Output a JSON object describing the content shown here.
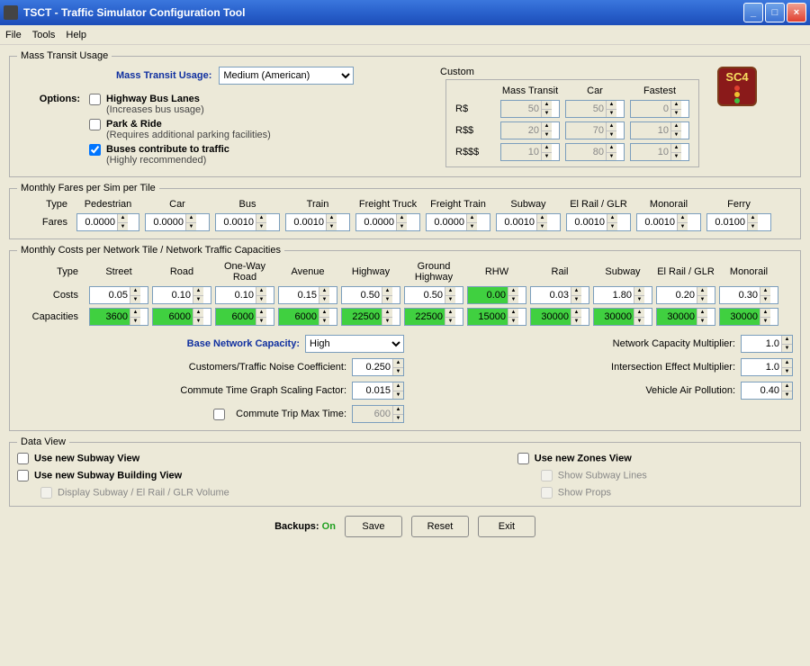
{
  "window": {
    "title": "TSCT - Traffic Simulator Configuration Tool"
  },
  "menu": {
    "file": "File",
    "tools": "Tools",
    "help": "Help"
  },
  "mtUsage": {
    "legend": "Mass Transit Usage",
    "label": "Mass Transit Usage:",
    "value": "Medium (American)",
    "optionsLabel": "Options:",
    "opt1": "Highway Bus Lanes",
    "opt1sub": "(Increases bus usage)",
    "opt2": "Park & Ride",
    "opt2sub": "(Requires additional parking facilities)",
    "opt3": "Buses contribute to traffic",
    "opt3sub": "(Highly recommended)",
    "customLabel": "Custom",
    "col1": "Mass Transit",
    "col2": "Car",
    "col3": "Fastest",
    "r1": "R$",
    "r2": "R$$",
    "r3": "R$$$",
    "v": {
      "r1c1": "50",
      "r1c2": "50",
      "r1c3": "0",
      "r2c1": "20",
      "r2c2": "70",
      "r2c3": "10",
      "r3c1": "10",
      "r3c2": "80",
      "r3c3": "10"
    },
    "logo": "SC4"
  },
  "fares": {
    "legend": "Monthly Fares per Sim per Tile",
    "typeLabel": "Type",
    "faresLabel": "Fares",
    "cols": [
      "Pedestrian",
      "Car",
      "Bus",
      "Train",
      "Freight Truck",
      "Freight Train",
      "Subway",
      "El Rail / GLR",
      "Monorail",
      "Ferry"
    ],
    "vals": [
      "0.0000",
      "0.0000",
      "0.0010",
      "0.0010",
      "0.0000",
      "0.0000",
      "0.0010",
      "0.0010",
      "0.0010",
      "0.0100"
    ]
  },
  "costs": {
    "legend": "Monthly Costs per Network Tile / Network Traffic Capacities",
    "typeLabel": "Type",
    "costsLabel": "Costs",
    "capLabel": "Capacities",
    "cols": [
      "Street",
      "Road",
      "One-Way Road",
      "Avenue",
      "Highway",
      "Ground Highway",
      "RHW",
      "Rail",
      "Subway",
      "El Rail / GLR",
      "Monorail"
    ],
    "costVals": [
      "0.05",
      "0.10",
      "0.10",
      "0.15",
      "0.50",
      "0.50",
      "0.00",
      "0.03",
      "1.80",
      "0.20",
      "0.30"
    ],
    "capVals": [
      "3600",
      "6000",
      "6000",
      "6000",
      "22500",
      "22500",
      "15000",
      "30000",
      "30000",
      "30000",
      "30000"
    ],
    "baseLabel": "Base Network Capacity:",
    "baseValue": "High",
    "noiseLabel": "Customers/Traffic Noise Coefficient:",
    "noiseVal": "0.250",
    "scaleLabel": "Commute Time Graph Scaling Factor:",
    "scaleVal": "0.015",
    "tripLabel": "Commute Trip Max Time:",
    "tripVal": "600",
    "multLabel": "Network Capacity Multiplier:",
    "multVal": "1.0",
    "interLabel": "Intersection Effect Multiplier:",
    "interVal": "1.0",
    "pollLabel": "Vehicle Air Pollution:",
    "pollVal": "0.40"
  },
  "dataView": {
    "legend": "Data View",
    "c1": "Use new Subway View",
    "c2": "Use new Subway Building View",
    "c3": "Display Subway / El Rail / GLR Volume",
    "c4": "Use new Zones View",
    "c5": "Show Subway Lines",
    "c6": "Show Props"
  },
  "footer": {
    "backups": "Backups:",
    "on": "On",
    "save": "Save",
    "reset": "Reset",
    "exit": "Exit"
  }
}
